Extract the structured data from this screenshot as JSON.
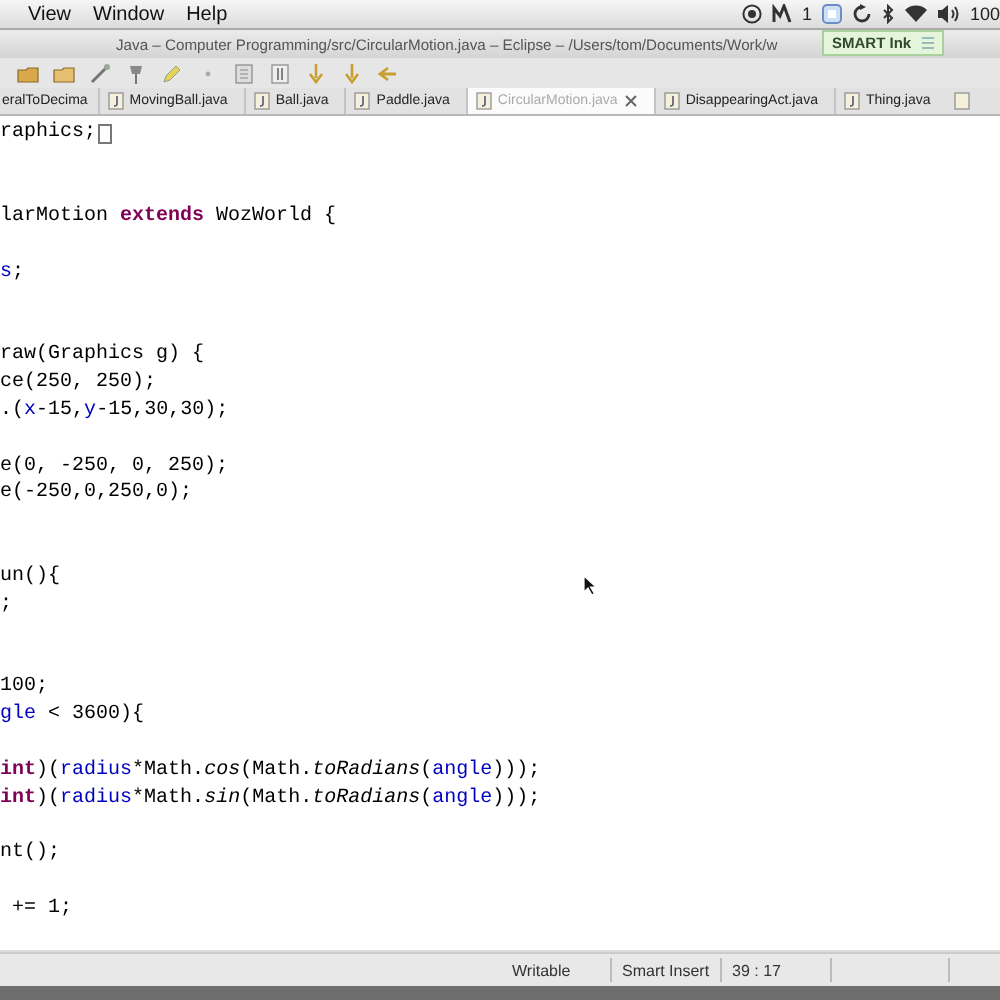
{
  "menu_bar": {
    "items": [
      "View",
      "Window",
      "Help"
    ],
    "status_items": [
      "1",
      "100"
    ]
  },
  "window": {
    "title": "Java – Computer Programming/src/CircularMotion.java – Eclipse – /Users/tom/Documents/Work/w",
    "overlay_badge": "SMART Ink"
  },
  "tabs": [
    {
      "label": "eralToDecima",
      "selected": false
    },
    {
      "label": "MovingBall.java",
      "selected": false
    },
    {
      "label": "Ball.java",
      "selected": false
    },
    {
      "label": "Paddle.java",
      "selected": false
    },
    {
      "label": "CircularMotion.java",
      "selected": true
    },
    {
      "label": "DisappearingAct.java",
      "selected": false
    },
    {
      "label": "Thing.java",
      "selected": false
    }
  ],
  "editor": {
    "lines": [
      {
        "cursor": true,
        "segments": [
          {
            "kind": "plain",
            "text": "raphics;"
          }
        ]
      },
      {
        "cursor": false
      },
      {
        "cursor": false
      },
      {
        "cursor": false,
        "segments": [
          {
            "kind": "plain",
            "text": "larMotion "
          },
          {
            "kind": "keyword",
            "text": "extends"
          },
          {
            "kind": "plain",
            "text": " WozWorld {"
          }
        ]
      },
      {
        "cursor": false
      },
      {
        "cursor": false,
        "segments": [
          {
            "kind": "field",
            "text": "s"
          },
          {
            "kind": "plain",
            "text": ";"
          }
        ]
      },
      {
        "cursor": false
      },
      {
        "cursor": false
      },
      {
        "cursor": false,
        "segments": [
          {
            "kind": "plain",
            "text": "raw(Graphics g) {"
          }
        ]
      },
      {
        "cursor": false,
        "segments": [
          {
            "kind": "plain",
            "text": "ce(250, 250);"
          }
        ]
      },
      {
        "cursor": false,
        "segments": [
          {
            "kind": "plain",
            "text": ".("
          },
          {
            "kind": "field",
            "text": "x"
          },
          {
            "kind": "plain",
            "text": "-15,"
          },
          {
            "kind": "field",
            "text": "y"
          },
          {
            "kind": "plain",
            "text": "-15,30,30);"
          }
        ]
      },
      {
        "cursor": false
      },
      {
        "cursor": false,
        "segments": [
          {
            "kind": "plain",
            "text": "e(0, -250, 0, 250);"
          }
        ]
      },
      {
        "cursor": false,
        "segments": [
          {
            "kind": "plain",
            "text": "e(-250,0,250,0);"
          }
        ]
      },
      {
        "cursor": false
      },
      {
        "cursor": false
      },
      {
        "cursor": false,
        "segments": [
          {
            "kind": "plain",
            "text": "un(){"
          }
        ]
      },
      {
        "cursor": false,
        "segments": [
          {
            "kind": "plain",
            "text": ";"
          }
        ]
      },
      {
        "cursor": false
      },
      {
        "cursor": false
      },
      {
        "cursor": false,
        "segments": [
          {
            "kind": "plain",
            "text": "100;"
          }
        ]
      },
      {
        "cursor": false,
        "segments": [
          {
            "kind": "field",
            "text": "gle"
          },
          {
            "kind": "plain",
            "text": " < 3600){"
          }
        ]
      },
      {
        "cursor": false
      },
      {
        "cursor": false,
        "segments": [
          {
            "kind": "keyword",
            "text": "int"
          },
          {
            "kind": "plain",
            "text": ")("
          },
          {
            "kind": "field",
            "text": "radius"
          },
          {
            "kind": "plain",
            "text": "*Math."
          },
          {
            "kind": "static",
            "text": "cos"
          },
          {
            "kind": "plain",
            "text": "(Math."
          },
          {
            "kind": "static",
            "text": "toRadians"
          },
          {
            "kind": "plain",
            "text": "("
          },
          {
            "kind": "field",
            "text": "angle"
          },
          {
            "kind": "plain",
            "text": ")));"
          }
        ]
      },
      {
        "cursor": false,
        "segments": [
          {
            "kind": "keyword",
            "text": "int"
          },
          {
            "kind": "plain",
            "text": ")("
          },
          {
            "kind": "field",
            "text": "radius"
          },
          {
            "kind": "plain",
            "text": "*Math."
          },
          {
            "kind": "static",
            "text": "sin"
          },
          {
            "kind": "plain",
            "text": "(Math."
          },
          {
            "kind": "static",
            "text": "toRadians"
          },
          {
            "kind": "plain",
            "text": "("
          },
          {
            "kind": "field",
            "text": "angle"
          },
          {
            "kind": "plain",
            "text": ")));"
          }
        ]
      },
      {
        "cursor": false
      },
      {
        "cursor": false,
        "segments": [
          {
            "kind": "plain",
            "text": "nt();"
          }
        ]
      },
      {
        "cursor": false
      },
      {
        "cursor": false,
        "segments": [
          {
            "kind": "plain",
            "text": " += 1;"
          }
        ]
      }
    ]
  },
  "status_bar": [
    "Writable",
    "Smart Insert",
    "39 : 17"
  ]
}
